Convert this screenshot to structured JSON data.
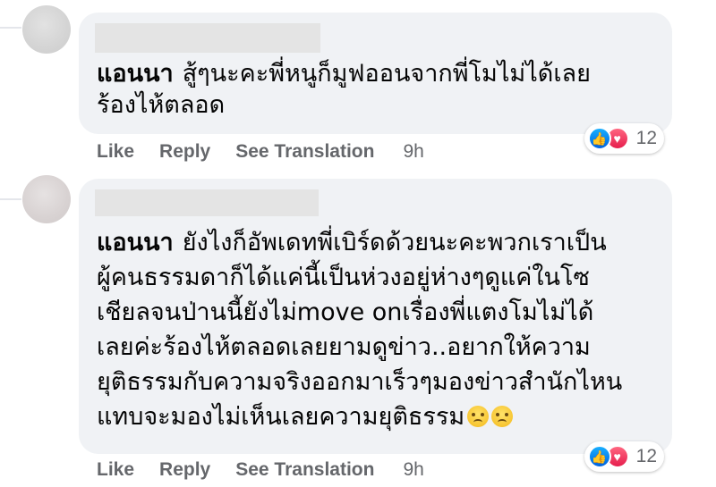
{
  "comments": [
    {
      "author": "แอนนา",
      "lines": [
        "สู้ๆนะคะพี่หนูก็มูฟออนจากพี่โมไม่ได้เลย",
        "ร้องไห้ตลอด"
      ],
      "actions": {
        "like": "Like",
        "reply": "Reply",
        "translate": "See Translation",
        "time": "9h"
      },
      "reaction_count": "12",
      "reaction_icons": [
        "like-icon",
        "love-icon"
      ]
    },
    {
      "author": "แอนนา",
      "lines": [
        "ยังไงก็อัพเดทพี่เบิร์ดด้วยนะคะพวกเราเป็น",
        "ผู้คนธรรมดาก็ได้แค่นี้เป็นห่วงอยู่ห่างๆดูแค่ในโซ",
        "เชียลจนป่านนี้ยังไม่move onเรื่องพี่แตงโมไม่ได้",
        "เลยค่ะร้องไห้ตลอดเลยยามดูข่าว..อยากให้ความ",
        "ยุติธรรมกับความจริงออกมาเร็วๆมองข่าวสำนักไหน",
        "แทบจะมองไม่เห็นเลยความยุติธรรม"
      ],
      "emojis": [
        "crying-face-icon",
        "crying-face-icon"
      ],
      "actions": {
        "like": "Like",
        "reply": "Reply",
        "translate": "See Translation",
        "time": "9h"
      },
      "reaction_count": "12",
      "reaction_icons": [
        "like-icon",
        "love-icon"
      ]
    }
  ],
  "colors": {
    "bubble": "#f0f2f5",
    "action_text": "#65676b",
    "like_blue": "#0062df",
    "love_red": "#e61e4d"
  }
}
